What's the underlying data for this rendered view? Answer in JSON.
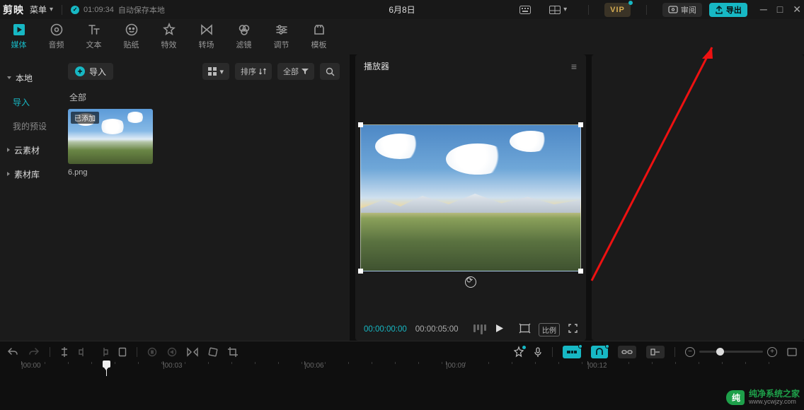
{
  "titlebar": {
    "logo": "剪映",
    "menu": "菜单",
    "sync_time": "01:09:34",
    "sync_text": "自动保存本地",
    "project_title": "6月8日",
    "vip": "VIP",
    "review": "审阅",
    "export": "导出"
  },
  "tabs": [
    {
      "label": "媒体"
    },
    {
      "label": "音频"
    },
    {
      "label": "文本"
    },
    {
      "label": "贴纸"
    },
    {
      "label": "特效"
    },
    {
      "label": "转场"
    },
    {
      "label": "滤镜"
    },
    {
      "label": "调节"
    },
    {
      "label": "模板"
    }
  ],
  "sidebar": {
    "items": [
      {
        "label": "本地",
        "kind": "expanded"
      },
      {
        "label": "导入",
        "kind": "sub-sel"
      },
      {
        "label": "我的预设",
        "kind": "sub"
      },
      {
        "label": "云素材",
        "kind": "collapsed"
      },
      {
        "label": "素材库",
        "kind": "collapsed"
      }
    ]
  },
  "media": {
    "import": "导入",
    "sort": "排序",
    "filter_all": "全部",
    "section_all": "全部",
    "thumb_badge": "已添加",
    "thumb_name": "6.png"
  },
  "player": {
    "title": "播放器",
    "current": "00:00:00:00",
    "total": "00:00:05:00",
    "ratio": "比例"
  },
  "ruler": {
    "t0": "|00:00",
    "t1": "|00:03",
    "t2": "|00:06",
    "t3": "|00:09",
    "t4": "|00:12"
  },
  "watermark": {
    "cn": "纯净系统之家",
    "en": "www.ycwjzy.com"
  }
}
